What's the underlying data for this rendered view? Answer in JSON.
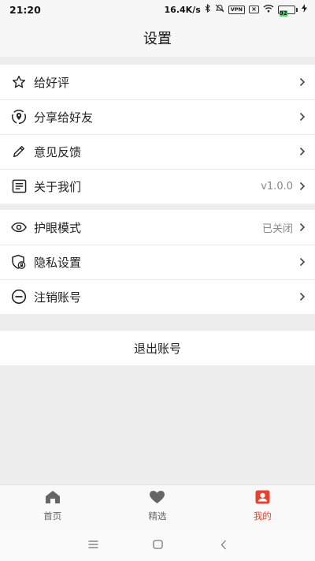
{
  "status_bar": {
    "time": "21:20",
    "network_speed": "16.4K/s",
    "vpn_label": "VPN",
    "battery_level": "92",
    "icons": [
      "bluetooth-icon",
      "mute-icon",
      "vpn-icon",
      "sim-off-icon",
      "wifi-icon",
      "battery-icon",
      "charging-icon"
    ]
  },
  "header": {
    "title": "设置"
  },
  "group1": {
    "items": [
      {
        "label": "给好评",
        "icon": "star-icon",
        "value": ""
      },
      {
        "label": "分享给好友",
        "icon": "share-location-icon",
        "value": ""
      },
      {
        "label": "意见反馈",
        "icon": "pencil-icon",
        "value": ""
      },
      {
        "label": "关于我们",
        "icon": "document-icon",
        "value": "v1.0.0"
      }
    ]
  },
  "group2": {
    "items": [
      {
        "label": "护眼模式",
        "icon": "eye-icon",
        "value": "已关闭"
      },
      {
        "label": "隐私设置",
        "icon": "shield-lock-icon",
        "value": ""
      },
      {
        "label": "注销账号",
        "icon": "minus-circle-icon",
        "value": ""
      }
    ]
  },
  "logout": {
    "label": "退出账号"
  },
  "tabbar": {
    "tabs": [
      {
        "label": "首页",
        "icon": "home-icon",
        "active": false
      },
      {
        "label": "精选",
        "icon": "heart-icon",
        "active": false
      },
      {
        "label": "我的",
        "icon": "profile-icon",
        "active": true
      }
    ],
    "active_color": "#e5432f"
  },
  "navbar": {
    "buttons": [
      "menu-icon",
      "home-square-icon",
      "back-icon"
    ]
  }
}
